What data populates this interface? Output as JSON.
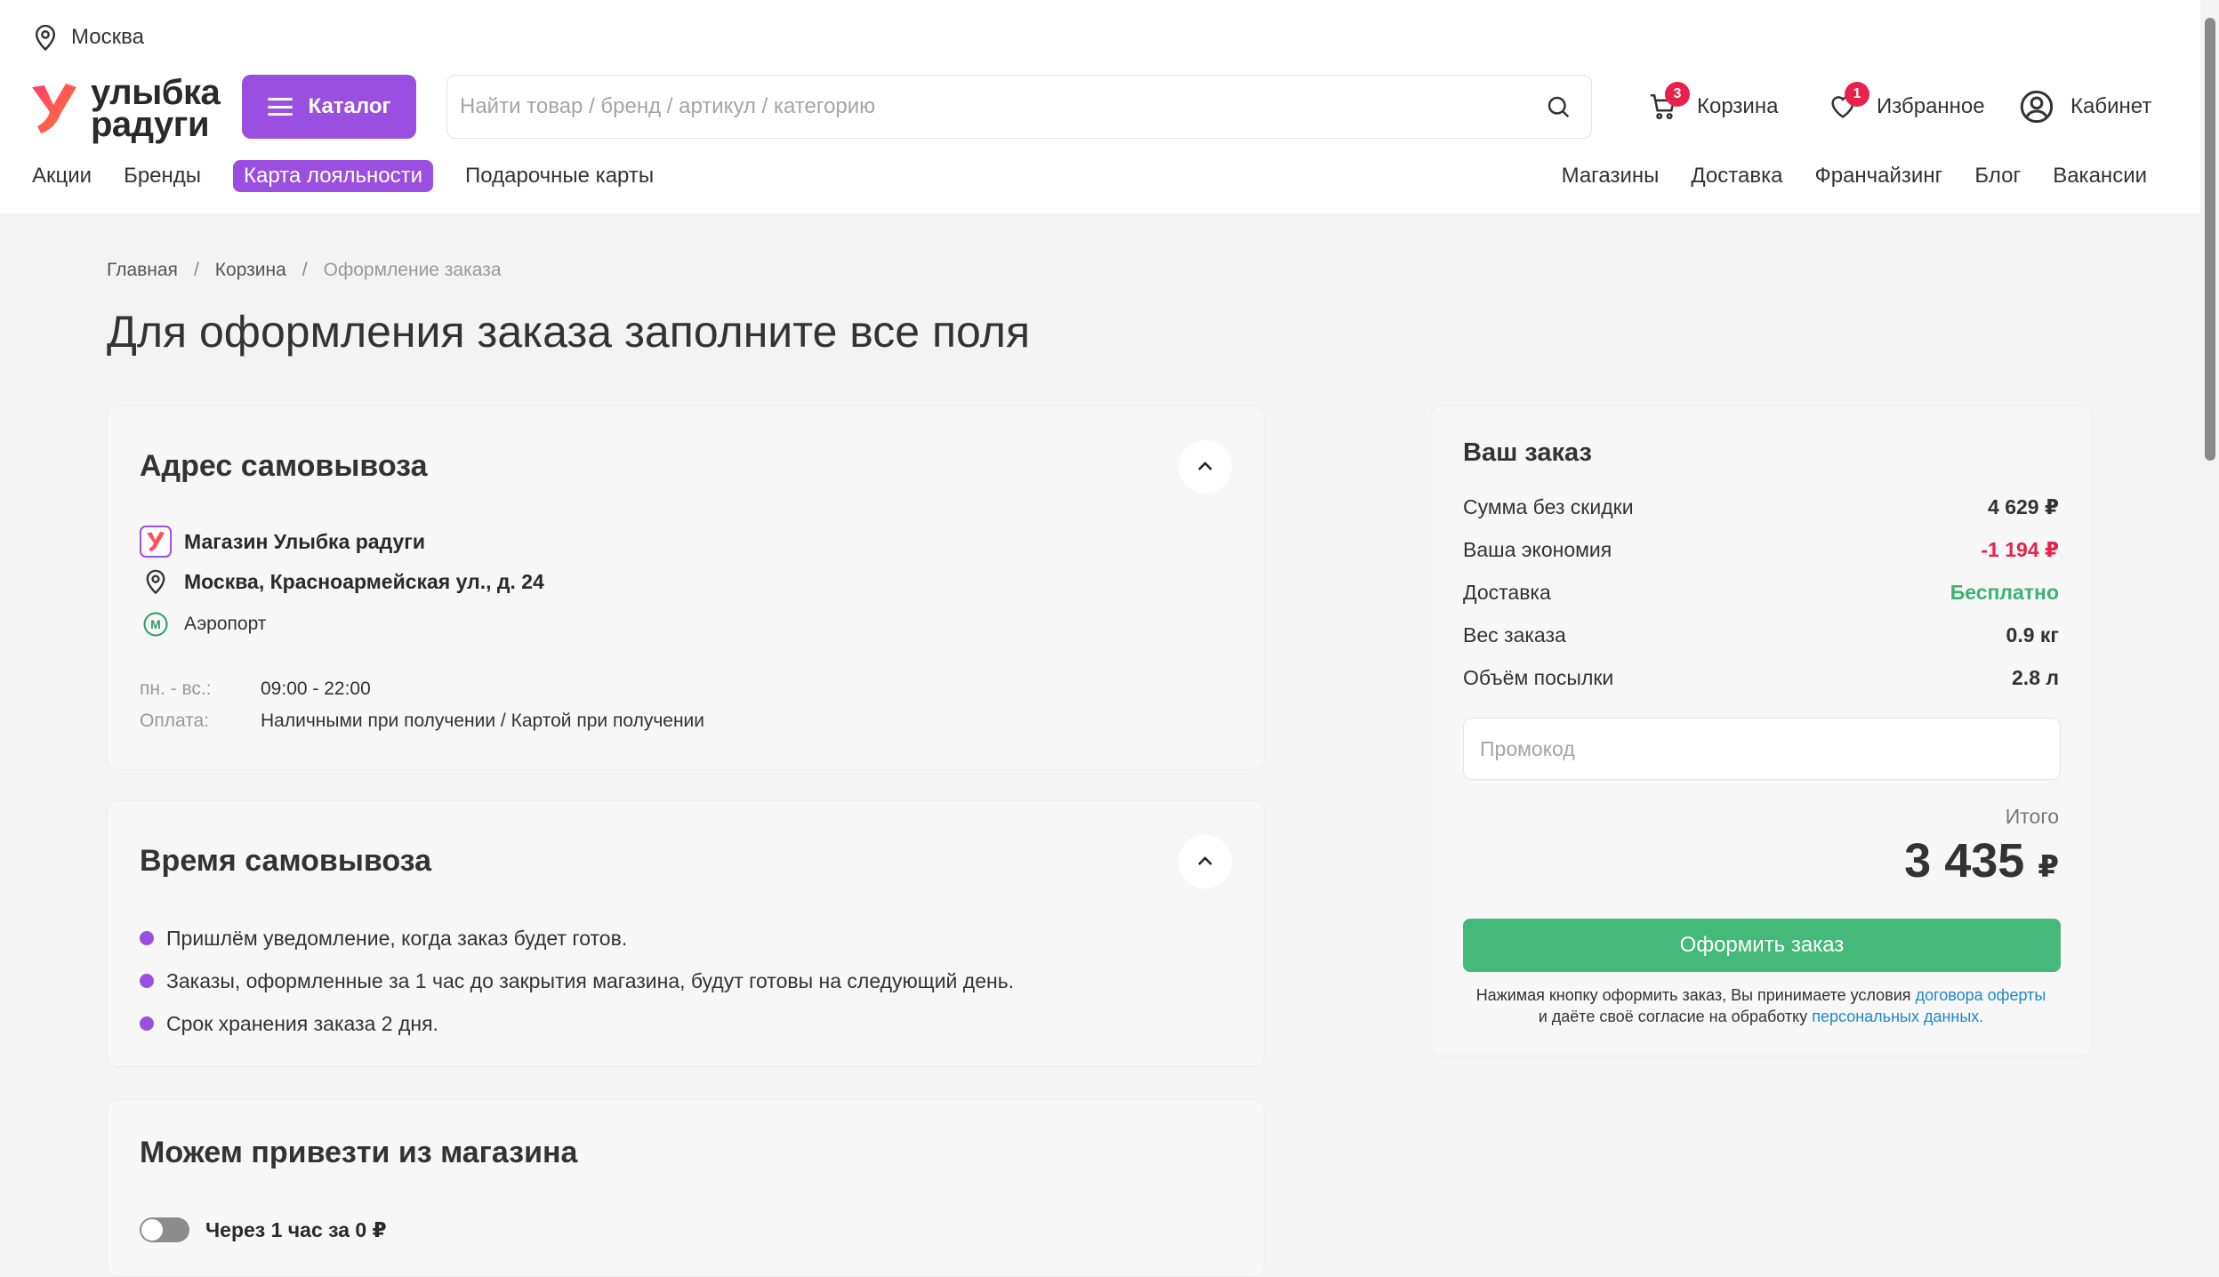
{
  "header": {
    "city": "Москва",
    "logo_line1": "улыбка",
    "logo_line2": "радуги",
    "catalog_label": "Каталог",
    "search_placeholder": "Найти товар / бренд / артикул / категорию",
    "cart_label": "Корзина",
    "cart_count": "3",
    "favorites_label": "Избранное",
    "favorites_count": "1",
    "cabinet_label": "Кабинет"
  },
  "nav": {
    "left": [
      "Акции",
      "Бренды",
      "Карта лояльности",
      "Подарочные карты"
    ],
    "right": [
      "Магазины",
      "Доставка",
      "Франчайзинг",
      "Блог",
      "Вакансии"
    ]
  },
  "breadcrumb": {
    "home": "Главная",
    "cart": "Корзина",
    "current": "Оформление заказа",
    "sep": "/"
  },
  "page_title": "Для оформления заказа заполните все поля",
  "pickup_address": {
    "title": "Адрес самовывоза",
    "shop_name": "Магазин Улыбка радуги",
    "address": "Москва, Красноармейская ул., д. 24",
    "metro": "Аэропорт",
    "hours_label": "пн. - вс.:",
    "hours_value": "09:00 - 22:00",
    "payment_label": "Оплата:",
    "payment_value": "Наличными при получении / Картой при получении"
  },
  "pickup_time": {
    "title": "Время самовывоза",
    "items": [
      "Пришлём уведомление, когда заказ будет готов.",
      "Заказы, оформленные за 1 час до закрытия магазина, будут готовы на следующий день.",
      "Срок хранения заказа 2 дня."
    ]
  },
  "delivery_from_shop": {
    "title": "Можем привезти из магазина",
    "option_label": "Через 1 час за 0 ₽",
    "option_enabled": false
  },
  "order_summary": {
    "title": "Ваш заказ",
    "rows": [
      {
        "label": "Сумма без скидки",
        "value": "4 629 ₽"
      },
      {
        "label": "Ваша экономия",
        "value": "-1 194 ₽"
      },
      {
        "label": "Доставка",
        "value": "Бесплатно"
      },
      {
        "label": "Вес заказа",
        "value": "0.9 кг"
      },
      {
        "label": "Объём посылки",
        "value": "2.8 л"
      }
    ],
    "promo_placeholder": "Промокод",
    "total_label": "Итого",
    "total_value": "3 435",
    "total_currency": "₽",
    "submit_label": "Оформить заказ",
    "legal_text_1": "Нажимая кнопку оформить заказ, Вы принимаете условия",
    "legal_link_1": "договора оферты",
    "legal_text_2": "и даёте своё согласие на обработку",
    "legal_link_2": "персональных данных."
  },
  "colors": {
    "accent_purple": "#9a4fe0",
    "badge_red": "#e8214a",
    "success_green": "#44b97a",
    "link_blue": "#1e88c8"
  }
}
